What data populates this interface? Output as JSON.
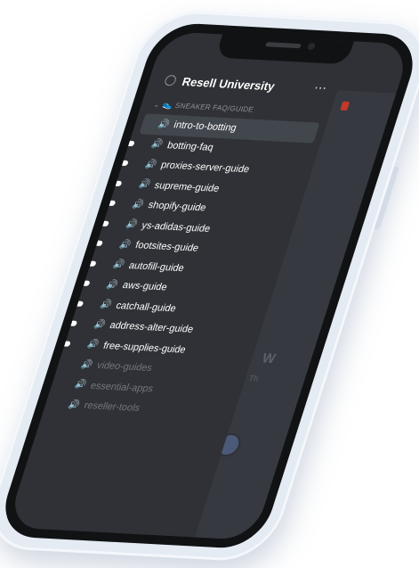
{
  "server": {
    "name": "Resell University"
  },
  "header": {
    "more_icon": "⋯"
  },
  "category": {
    "name": "SNEAKER FAQ/GUIDE",
    "emoji": "👟",
    "chevron": "⌄"
  },
  "channels": [
    {
      "name": "intro-to-botting",
      "selected": true,
      "unread": false,
      "muted": false
    },
    {
      "name": "botting-faq",
      "selected": false,
      "unread": true,
      "muted": false
    },
    {
      "name": "proxies-server-guide",
      "selected": false,
      "unread": true,
      "muted": false
    },
    {
      "name": "supreme-guide",
      "selected": false,
      "unread": true,
      "muted": false
    },
    {
      "name": "shopify-guide",
      "selected": false,
      "unread": true,
      "muted": false
    },
    {
      "name": "ys-adidas-guide",
      "selected": false,
      "unread": true,
      "muted": false
    },
    {
      "name": "footsites-guide",
      "selected": false,
      "unread": true,
      "muted": false
    },
    {
      "name": "autofill-guide",
      "selected": false,
      "unread": true,
      "muted": false
    },
    {
      "name": "aws-guide",
      "selected": false,
      "unread": true,
      "muted": false
    },
    {
      "name": "catchall-guide",
      "selected": false,
      "unread": true,
      "muted": false
    },
    {
      "name": "address-alter-guide",
      "selected": false,
      "unread": true,
      "muted": false
    },
    {
      "name": "free-supplies-guide",
      "selected": false,
      "unread": true,
      "muted": false
    },
    {
      "name": "video-guides",
      "selected": false,
      "unread": false,
      "muted": true
    },
    {
      "name": "essential-apps",
      "selected": false,
      "unread": false,
      "muted": true
    },
    {
      "name": "reseller-tools",
      "selected": false,
      "unread": false,
      "muted": true
    }
  ],
  "channel_icon": "🔊",
  "background_peek": {
    "letter": "W",
    "sub": "Th"
  },
  "colors": {
    "sidebar": "#2f3136",
    "main": "#36393f",
    "selected": "#42464d",
    "text": "#ffffff",
    "muted": "#72767d"
  }
}
